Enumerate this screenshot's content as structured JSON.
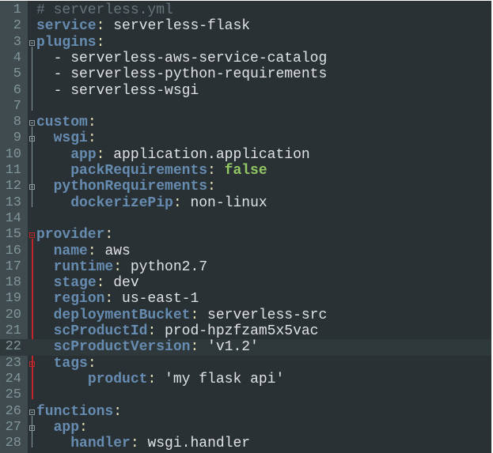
{
  "editor": {
    "file_comment": "# serverless.yml",
    "current_line": 22,
    "lines": [
      [
        {
          "t": "# serverless.yml",
          "c": "c"
        }
      ],
      [
        {
          "t": "service",
          "c": "k"
        },
        {
          "t": ": ",
          "c": "p"
        },
        {
          "t": "serverless-flask",
          "c": "v"
        }
      ],
      [
        {
          "t": "plugins",
          "c": "k"
        },
        {
          "t": ":",
          "c": "p"
        }
      ],
      [
        {
          "t": "  - serverless-aws-service-catalog",
          "c": "v"
        }
      ],
      [
        {
          "t": "  - serverless-python-requirements",
          "c": "v"
        }
      ],
      [
        {
          "t": "  - serverless-wsgi",
          "c": "v"
        }
      ],
      [],
      [
        {
          "t": "custom",
          "c": "k"
        },
        {
          "t": ":",
          "c": "p"
        }
      ],
      [
        {
          "t": "  ",
          "c": "v"
        },
        {
          "t": "wsgi",
          "c": "k"
        },
        {
          "t": ":",
          "c": "p"
        }
      ],
      [
        {
          "t": "    ",
          "c": "v"
        },
        {
          "t": "app",
          "c": "k"
        },
        {
          "t": ": ",
          "c": "p"
        },
        {
          "t": "application.application",
          "c": "v"
        }
      ],
      [
        {
          "t": "    ",
          "c": "v"
        },
        {
          "t": "packRequirements",
          "c": "k"
        },
        {
          "t": ": ",
          "c": "p"
        },
        {
          "t": "false",
          "c": "b"
        }
      ],
      [
        {
          "t": "  ",
          "c": "v"
        },
        {
          "t": "pythonRequirements",
          "c": "k"
        },
        {
          "t": ":",
          "c": "p"
        }
      ],
      [
        {
          "t": "    ",
          "c": "v"
        },
        {
          "t": "dockerizePip",
          "c": "k"
        },
        {
          "t": ": ",
          "c": "p"
        },
        {
          "t": "non-linux",
          "c": "v"
        }
      ],
      [],
      [
        {
          "t": "provider",
          "c": "k"
        },
        {
          "t": ":",
          "c": "p"
        }
      ],
      [
        {
          "t": "  ",
          "c": "v"
        },
        {
          "t": "name",
          "c": "k"
        },
        {
          "t": ": ",
          "c": "p"
        },
        {
          "t": "aws",
          "c": "v"
        }
      ],
      [
        {
          "t": "  ",
          "c": "v"
        },
        {
          "t": "runtime",
          "c": "k"
        },
        {
          "t": ": ",
          "c": "p"
        },
        {
          "t": "python2.7",
          "c": "v"
        }
      ],
      [
        {
          "t": "  ",
          "c": "v"
        },
        {
          "t": "stage",
          "c": "k"
        },
        {
          "t": ": ",
          "c": "p"
        },
        {
          "t": "dev",
          "c": "v"
        }
      ],
      [
        {
          "t": "  ",
          "c": "v"
        },
        {
          "t": "region",
          "c": "k"
        },
        {
          "t": ": ",
          "c": "p"
        },
        {
          "t": "us-east-1",
          "c": "v"
        }
      ],
      [
        {
          "t": "  ",
          "c": "v"
        },
        {
          "t": "deploymentBucket",
          "c": "k"
        },
        {
          "t": ": ",
          "c": "p"
        },
        {
          "t": "serverless-src",
          "c": "v"
        }
      ],
      [
        {
          "t": "  ",
          "c": "v"
        },
        {
          "t": "scProductId",
          "c": "k"
        },
        {
          "t": ": ",
          "c": "p"
        },
        {
          "t": "prod-hpzfzam5x5vac",
          "c": "v"
        }
      ],
      [
        {
          "t": "  ",
          "c": "v"
        },
        {
          "t": "scProductVersion",
          "c": "k"
        },
        {
          "t": ": ",
          "c": "p"
        },
        {
          "t": "'v1.2'",
          "c": "v"
        }
      ],
      [
        {
          "t": "  ",
          "c": "v"
        },
        {
          "t": "tags",
          "c": "k"
        },
        {
          "t": ":",
          "c": "p"
        }
      ],
      [
        {
          "t": "      ",
          "c": "v"
        },
        {
          "t": "product",
          "c": "k"
        },
        {
          "t": ": ",
          "c": "p"
        },
        {
          "t": "'my flask api'",
          "c": "v"
        }
      ],
      [],
      [
        {
          "t": "functions",
          "c": "k"
        },
        {
          "t": ":",
          "c": "p"
        }
      ],
      [
        {
          "t": "  ",
          "c": "v"
        },
        {
          "t": "app",
          "c": "k"
        },
        {
          "t": ":",
          "c": "p"
        }
      ],
      [
        {
          "t": "    ",
          "c": "v"
        },
        {
          "t": "handler",
          "c": "k"
        },
        {
          "t": ": ",
          "c": "p"
        },
        {
          "t": "wsgi.handler",
          "c": "v"
        }
      ]
    ],
    "folds": [
      3,
      8,
      9,
      12,
      15,
      23,
      26,
      27
    ],
    "red_folds": [
      15,
      23
    ]
  }
}
